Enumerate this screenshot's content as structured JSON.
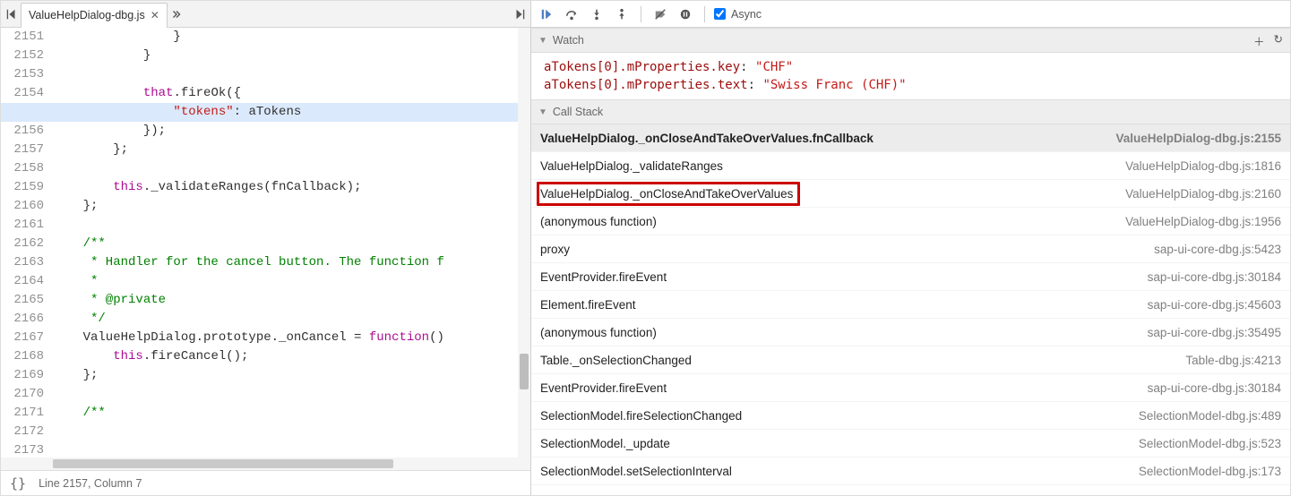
{
  "tab": {
    "filename": "ValueHelpDialog-dbg.js"
  },
  "status": {
    "pos": "Line 2157, Column 7"
  },
  "async_label": "Async",
  "gutter_start": 2151,
  "gutter_lines": 23,
  "active_line": 2155,
  "code_lines": [
    "                }",
    "            }",
    "",
    "            that.fireOk({",
    "                \"tokens\": aTokens",
    "            });",
    "        };",
    "",
    "        this._validateRanges(fnCallback);",
    "    };",
    "",
    "    /**",
    "     * Handler for the cancel button. The function f",
    "     *",
    "     * @private",
    "     */",
    "    ValueHelpDialog.prototype._onCancel = function()",
    "        this.fireCancel();",
    "    };",
    "",
    "    /**",
    "      ",
    ""
  ],
  "watch_label": "Watch",
  "watch": [
    {
      "expr": "aTokens[0].mProperties.key",
      "val": "\"CHF\""
    },
    {
      "expr": "aTokens[0].mProperties.text",
      "val": "\"Swiss Franc (CHF)\""
    }
  ],
  "callstack_label": "Call Stack",
  "stack": [
    {
      "fn": "ValueHelpDialog._onCloseAndTakeOverValues.fnCallback",
      "loc": "ValueHelpDialog-dbg.js:2155",
      "active": true
    },
    {
      "fn": "ValueHelpDialog._validateRanges",
      "loc": "ValueHelpDialog-dbg.js:1816"
    },
    {
      "fn": "ValueHelpDialog._onCloseAndTakeOverValues",
      "loc": "ValueHelpDialog-dbg.js:2160",
      "hl": true
    },
    {
      "fn": "(anonymous function)",
      "loc": "ValueHelpDialog-dbg.js:1956"
    },
    {
      "fn": "proxy",
      "loc": "sap-ui-core-dbg.js:5423"
    },
    {
      "fn": "EventProvider.fireEvent",
      "loc": "sap-ui-core-dbg.js:30184"
    },
    {
      "fn": "Element.fireEvent",
      "loc": "sap-ui-core-dbg.js:45603"
    },
    {
      "fn": "(anonymous function)",
      "loc": "sap-ui-core-dbg.js:35495"
    },
    {
      "fn": "Table._onSelectionChanged",
      "loc": "Table-dbg.js:4213"
    },
    {
      "fn": "EventProvider.fireEvent",
      "loc": "sap-ui-core-dbg.js:30184"
    },
    {
      "fn": "SelectionModel.fireSelectionChanged",
      "loc": "SelectionModel-dbg.js:489"
    },
    {
      "fn": "SelectionModel._update",
      "loc": "SelectionModel-dbg.js:523"
    },
    {
      "fn": "SelectionModel.setSelectionInterval",
      "loc": "SelectionModel-dbg.js:173"
    }
  ]
}
